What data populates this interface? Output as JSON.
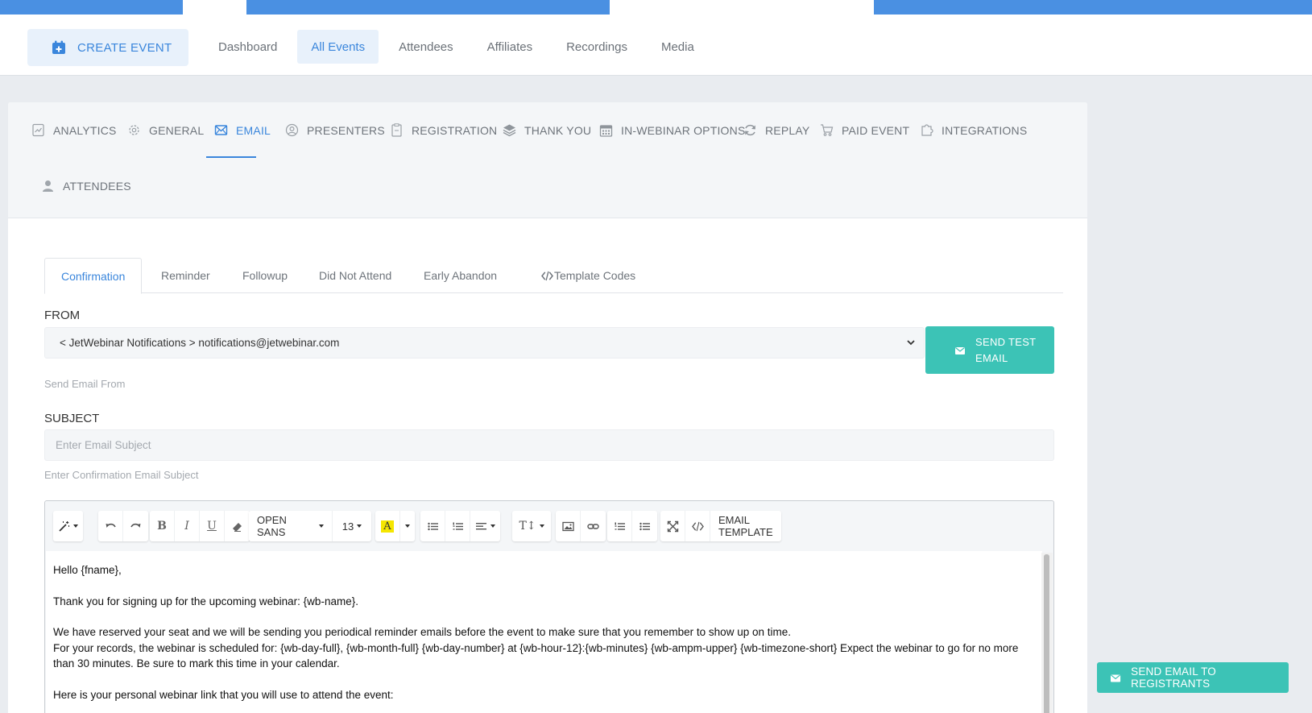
{
  "header": {
    "create_event_label": "CREATE EVENT",
    "nav": [
      {
        "label": "Dashboard",
        "active": false
      },
      {
        "label": "All Events",
        "active": true
      },
      {
        "label": "Attendees",
        "active": false
      },
      {
        "label": "Affiliates",
        "active": false
      },
      {
        "label": "Recordings",
        "active": false
      },
      {
        "label": "Media",
        "active": false
      }
    ]
  },
  "event_tabs": [
    {
      "label": "ANALYTICS",
      "icon": "analytics-icon"
    },
    {
      "label": "GENERAL",
      "icon": "gear-icon"
    },
    {
      "label": "EMAIL",
      "icon": "envelope-icon",
      "active": true
    },
    {
      "label": "PRESENTERS",
      "icon": "user-circle-icon"
    },
    {
      "label": "REGISTRATION",
      "icon": "clipboard-icon"
    },
    {
      "label": "THANK YOU",
      "icon": "layers-icon"
    },
    {
      "label": "IN-WEBINAR OPTIONS",
      "icon": "calendar-icon"
    },
    {
      "label": "REPLAY",
      "icon": "refresh-icon"
    },
    {
      "label": "PAID EVENT",
      "icon": "cart-icon"
    },
    {
      "label": "INTEGRATIONS",
      "icon": "puzzle-icon"
    },
    {
      "label": "ATTENDEES",
      "icon": "person-icon"
    }
  ],
  "email_tabs": [
    {
      "label": "Confirmation",
      "active": true
    },
    {
      "label": "Reminder"
    },
    {
      "label": "Followup"
    },
    {
      "label": "Did Not Attend"
    },
    {
      "label": "Early Abandon"
    },
    {
      "label": "Template Codes",
      "icon": "code-icon"
    }
  ],
  "from": {
    "label": "FROM",
    "value": "< JetWebinar Notifications > notifications@jetwebinar.com",
    "hint": "Send Email From",
    "send_test_label": "SEND TEST EMAIL"
  },
  "subject": {
    "label": "SUBJECT",
    "placeholder": "Enter Email Subject",
    "hint": "Enter Confirmation Email Subject"
  },
  "toolbar": {
    "font_family": "OPEN SANS",
    "font_size": "13",
    "email_template_label": "EMAIL TEMPLATE",
    "highlight_color": "#f5e600"
  },
  "editor": {
    "lines": [
      "Hello {fname},",
      "",
      "Thank you for signing up for the upcoming webinar: {wb-name}.",
      "",
      "We have reserved your seat and we will be sending you periodical reminder emails before the event to make sure that you remember to show up on time.",
      "For your records, the webinar is scheduled for: {wb-day-full}, {wb-month-full} {wb-day-number} at {wb-hour-12}:{wb-minutes} {wb-ampm-upper} {wb-timezone-short} Expect the webinar to go for no more than 30 minutes. Be sure to mark this time in your calendar.",
      "",
      "Here is your personal webinar link that you will use to attend the event:"
    ]
  },
  "send_registrants_label": "SEND EMAIL TO REGISTRANTS",
  "colors": {
    "accent": "#3a86dc",
    "teal": "#3cc3b6",
    "top_strip": "#4a90e2"
  }
}
